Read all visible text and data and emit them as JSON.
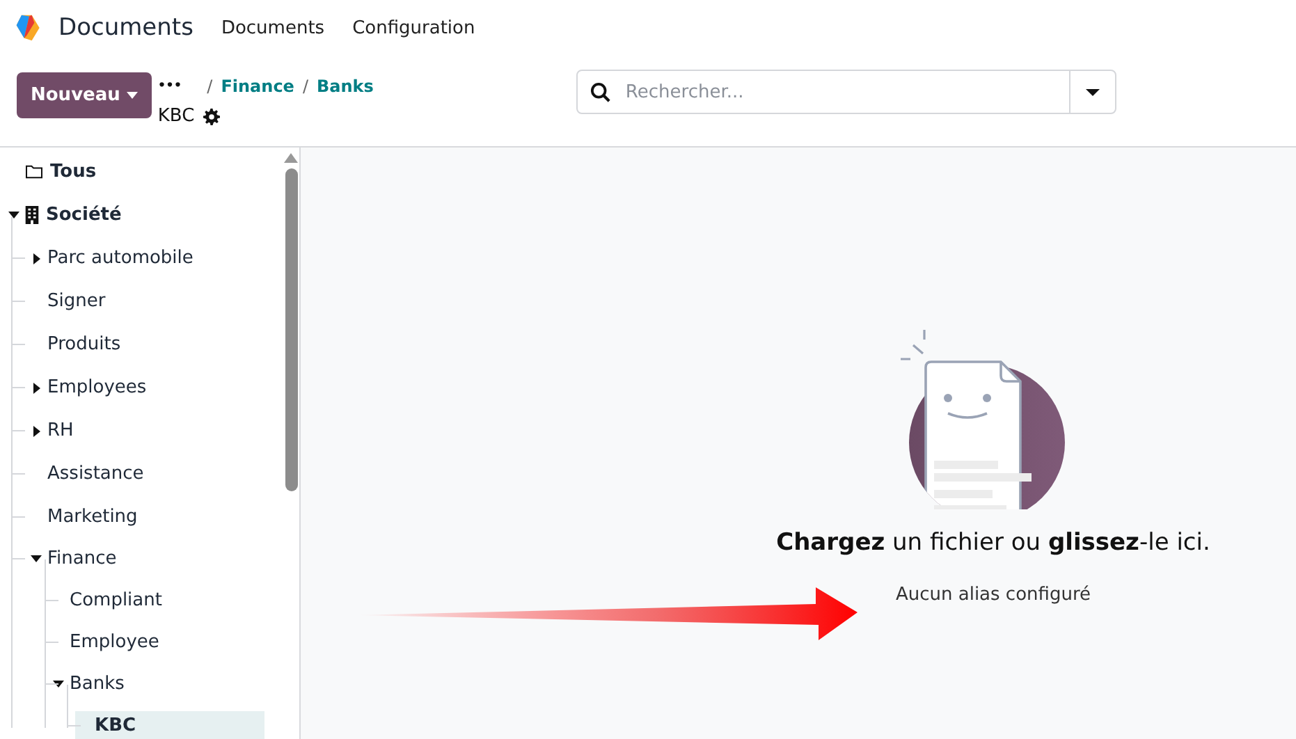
{
  "app": {
    "name": "Documents",
    "menu": [
      "Documents",
      "Configuration"
    ]
  },
  "control_panel": {
    "new_button": "Nouveau",
    "breadcrumb_more": "•••",
    "breadcrumbs": [
      {
        "separator": "/",
        "label": "Finance"
      },
      {
        "separator": "/",
        "label": "Banks"
      }
    ],
    "current": "KBC"
  },
  "search": {
    "placeholder": "Rechercher..."
  },
  "tree": [
    {
      "label": "Tous",
      "kind": "all",
      "selected": false
    },
    {
      "label": "Société",
      "kind": "company",
      "expanded": true,
      "selected": false,
      "children": [
        {
          "label": "Parc automobile",
          "expanded": false,
          "selected": false
        },
        {
          "label": "Signer",
          "selected": false
        },
        {
          "label": "Produits",
          "selected": false
        },
        {
          "label": "Employees",
          "expanded": false,
          "selected": false
        },
        {
          "label": "RH",
          "expanded": false,
          "selected": false
        },
        {
          "label": "Assistance",
          "selected": false
        },
        {
          "label": "Marketing",
          "selected": false
        },
        {
          "label": "Finance",
          "expanded": true,
          "selected": false,
          "children": [
            {
              "label": "Compliant",
              "selected": false
            },
            {
              "label": "Employee",
              "selected": false
            },
            {
              "label": "Banks",
              "expanded": true,
              "selected": false,
              "children": [
                {
                  "label": "KBC",
                  "selected": true
                }
              ]
            }
          ]
        }
      ]
    }
  ],
  "empty_state": {
    "title": "**Chargez** un fichier ou **glissez**-le ici.",
    "subtitle": "Aucun alias configuré"
  }
}
